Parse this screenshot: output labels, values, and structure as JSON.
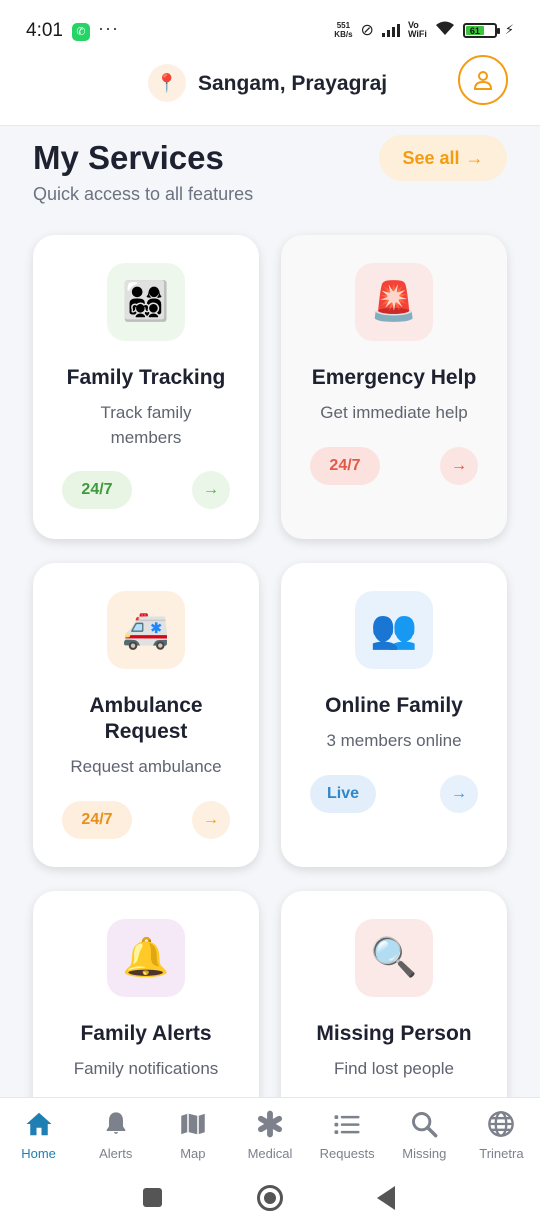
{
  "status_bar": {
    "time": "4:01",
    "net_speed_top": "551",
    "net_speed_bottom": "KB/s",
    "vo": "Vo",
    "wifi_label": "WiFi",
    "battery": "61"
  },
  "header": {
    "location": "Sangam, Prayagraj"
  },
  "section": {
    "title": "My Services",
    "subtitle": "Quick access to all features",
    "see_all": "See all"
  },
  "cards": [
    {
      "title": "Family Tracking",
      "subtitle": "Track family members",
      "badge": "24/7",
      "emoji": "👨‍👩‍👧‍👦",
      "accent": "#4caf50"
    },
    {
      "title": "Emergency Help",
      "subtitle": "Get immediate help",
      "badge": "24/7",
      "emoji": "🚨",
      "accent": "#e74c3c"
    },
    {
      "title": "Ambulance Request",
      "subtitle": "Request ambulance",
      "badge": "24/7",
      "emoji": "🚑",
      "accent": "#f39c12"
    },
    {
      "title": "Online Family",
      "subtitle": "3 members online",
      "badge": "Live",
      "emoji": "👥",
      "accent": "#3498db"
    },
    {
      "title": "Family Alerts",
      "subtitle": "Family notifications",
      "emoji": "🔔",
      "accent": "#9b59b6"
    },
    {
      "title": "Missing Person",
      "subtitle": "Find lost people",
      "emoji": "🔍",
      "accent": "#e74c3c"
    }
  ],
  "nav": {
    "items": [
      {
        "label": "Home",
        "icon": "home-icon",
        "active": true
      },
      {
        "label": "Alerts",
        "icon": "bell-icon"
      },
      {
        "label": "Map",
        "icon": "map-icon"
      },
      {
        "label": "Medical",
        "icon": "medical-icon"
      },
      {
        "label": "Requests",
        "icon": "list-icon"
      },
      {
        "label": "Missing",
        "icon": "search-icon"
      },
      {
        "label": "Trinetra",
        "icon": "globe-icon"
      }
    ]
  },
  "colors": {
    "primary": "#1f7fb2",
    "accent": "#f39c12"
  }
}
